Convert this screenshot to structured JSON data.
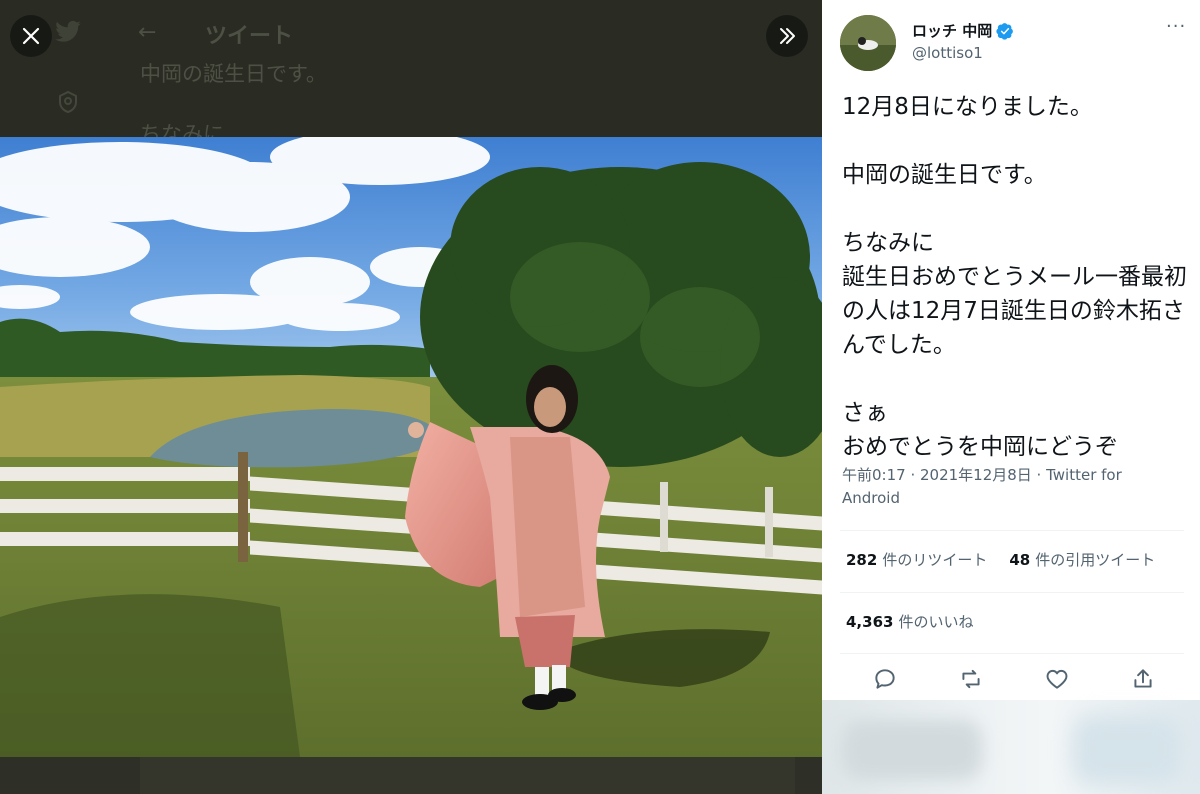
{
  "backdrop": {
    "back_arrow": "←",
    "title": "ツイート",
    "line1": "中岡の誕生日です。",
    "line2": "ちなみに"
  },
  "viewer": {
    "close_icon": "close-icon",
    "expand_icon": "chevron-double-right-icon"
  },
  "tweet": {
    "author_name": "ロッチ 中岡",
    "author_handle": "@lottiso1",
    "more_label": "···",
    "text": "12月8日になりました。\n\n中岡の誕生日です。\n\nちなみに\n誕生日おめでとうメール一番最初の人は12月7日誕生日の鈴木拓さんでした。\n\nさぁ\nおめでとうを中岡にどうぞ",
    "time": "午前0:17 · 2021年12月8日 · ",
    "source": "Twitter for Android",
    "retweets_count": "282",
    "retweets_label": "件のリツイート",
    "quotes_count": "48",
    "quotes_label": "件の引用ツイート",
    "likes_count": "4,363",
    "likes_label": "件のいいね"
  },
  "colors": {
    "verified": "#1d9bf0",
    "text": "#0f1419",
    "secondary": "#536471",
    "backdrop": "#2a2c23"
  }
}
